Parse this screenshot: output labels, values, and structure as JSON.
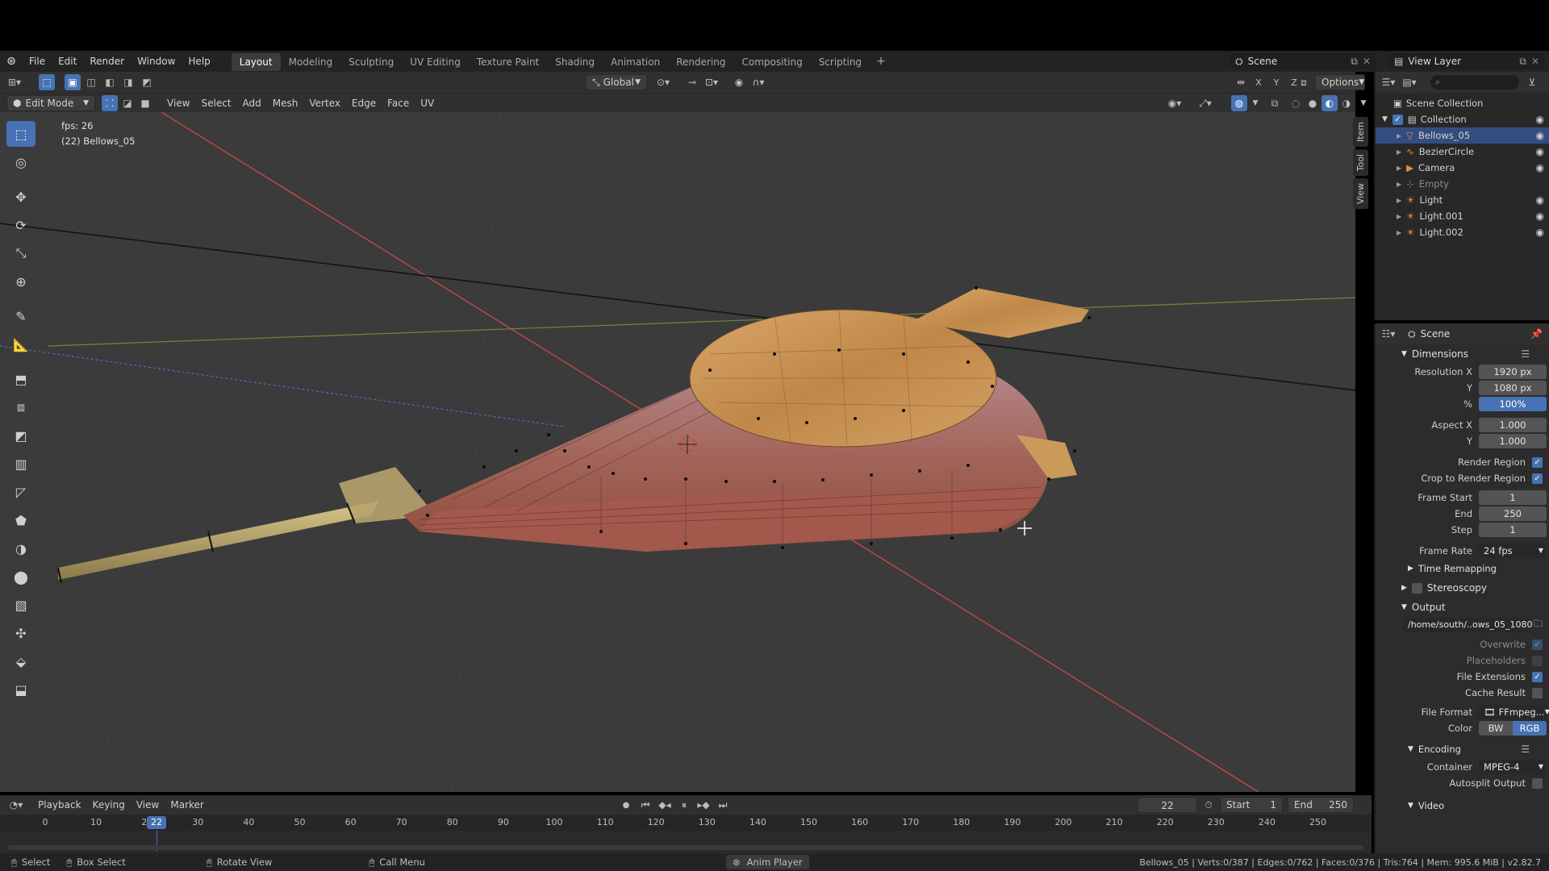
{
  "menus": [
    "File",
    "Edit",
    "Render",
    "Window",
    "Help"
  ],
  "workspaces": [
    {
      "label": "Layout",
      "active": true
    },
    {
      "label": "Modeling",
      "active": false
    },
    {
      "label": "Sculpting",
      "active": false
    },
    {
      "label": "UV Editing",
      "active": false
    },
    {
      "label": "Texture Paint",
      "active": false
    },
    {
      "label": "Shading",
      "active": false
    },
    {
      "label": "Animation",
      "active": false
    },
    {
      "label": "Rendering",
      "active": false
    },
    {
      "label": "Compositing",
      "active": false
    },
    {
      "label": "Scripting",
      "active": false
    }
  ],
  "add_workspace": "+",
  "scene_name": "Scene",
  "view_layer_name": "View Layer",
  "header": {
    "transform_orientation": "Global",
    "axes": [
      "X",
      "Y",
      "Z"
    ],
    "options": "Options",
    "mode": "Edit Mode",
    "view_menus": [
      "View",
      "Select",
      "Add",
      "Mesh",
      "Vertex",
      "Edge",
      "Face",
      "UV"
    ]
  },
  "overlay": {
    "fps": "fps: 26",
    "object": "(22) Bellows_05"
  },
  "npanel_tabs": [
    "Item",
    "Tool",
    "View"
  ],
  "outliner": {
    "scene_collection": "Scene Collection",
    "collection": "Collection",
    "items": [
      {
        "name": "Bellows_05",
        "selected": true,
        "icon": "mesh-icon",
        "dim": false
      },
      {
        "name": "BezierCircle",
        "selected": false,
        "icon": "curve-icon",
        "dim": false
      },
      {
        "name": "Camera",
        "selected": false,
        "icon": "camera-icon",
        "dim": false
      },
      {
        "name": "Empty",
        "selected": false,
        "icon": "empty-icon",
        "dim": true
      },
      {
        "name": "Light",
        "selected": false,
        "icon": "light-icon",
        "dim": false
      },
      {
        "name": "Light.001",
        "selected": false,
        "icon": "light-icon",
        "dim": false
      },
      {
        "name": "Light.002",
        "selected": false,
        "icon": "light-icon",
        "dim": false
      }
    ]
  },
  "properties": {
    "context": "Scene",
    "dimensions": "Dimensions",
    "resolution_x_label": "Resolution X",
    "resolution_x": "1920 px",
    "resolution_y_label": "Y",
    "resolution_y": "1080 px",
    "percent_label": "%",
    "percent": "100%",
    "aspect_x_label": "Aspect X",
    "aspect_x": "1.000",
    "aspect_y_label": "Y",
    "aspect_y": "1.000",
    "render_region": "Render Region",
    "crop_region": "Crop to Render Region",
    "frame_start_label": "Frame Start",
    "frame_start": "1",
    "end_label": "End",
    "end": "250",
    "step_label": "Step",
    "step": "1",
    "frame_rate_label": "Frame Rate",
    "frame_rate": "24 fps",
    "time_remapping": "Time Remapping",
    "stereoscopy": "Stereoscopy",
    "output": "Output",
    "output_path": "/home/south/..ows_05_1080",
    "overwrite": "Overwrite",
    "placeholders": "Placeholders",
    "file_extensions": "File Extensions",
    "cache_result": "Cache Result",
    "file_format_label": "File Format",
    "file_format": "FFmpeg...",
    "color_label": "Color",
    "color_bw": "BW",
    "color_rgb": "RGB",
    "encoding": "Encoding",
    "container_label": "Container",
    "container": "MPEG-4",
    "autosplit": "Autosplit Output",
    "video": "Video"
  },
  "timeline": {
    "menus": [
      "Playback",
      "Keying",
      "View",
      "Marker"
    ],
    "current_frame": "22",
    "start_label": "Start",
    "start": "1",
    "end_label": "End",
    "end": "250",
    "ticks": [
      "0",
      "10",
      "20",
      "30",
      "40",
      "50",
      "60",
      "70",
      "80",
      "90",
      "100",
      "110",
      "120",
      "130",
      "140",
      "150",
      "160",
      "170",
      "180",
      "190",
      "200",
      "210",
      "220",
      "230",
      "240",
      "250"
    ],
    "playhead": "22"
  },
  "statusbar": {
    "select": "Select",
    "box_select": "Box Select",
    "rotate_view": "Rotate View",
    "call_menu": "Call Menu",
    "anim_player": "Anim Player",
    "stats": "Bellows_05 | Verts:0/387 | Edges:0/762 | Faces:0/376 | Tris:764 | Mem: 995.6 MiB | v2.82.7"
  },
  "colors": {
    "accent": "#4772b3",
    "selected_row": "#334d80",
    "viewport_bg": "#3b3b3b",
    "mesh_body": "#a86b5a",
    "wood": "#c9955a"
  }
}
